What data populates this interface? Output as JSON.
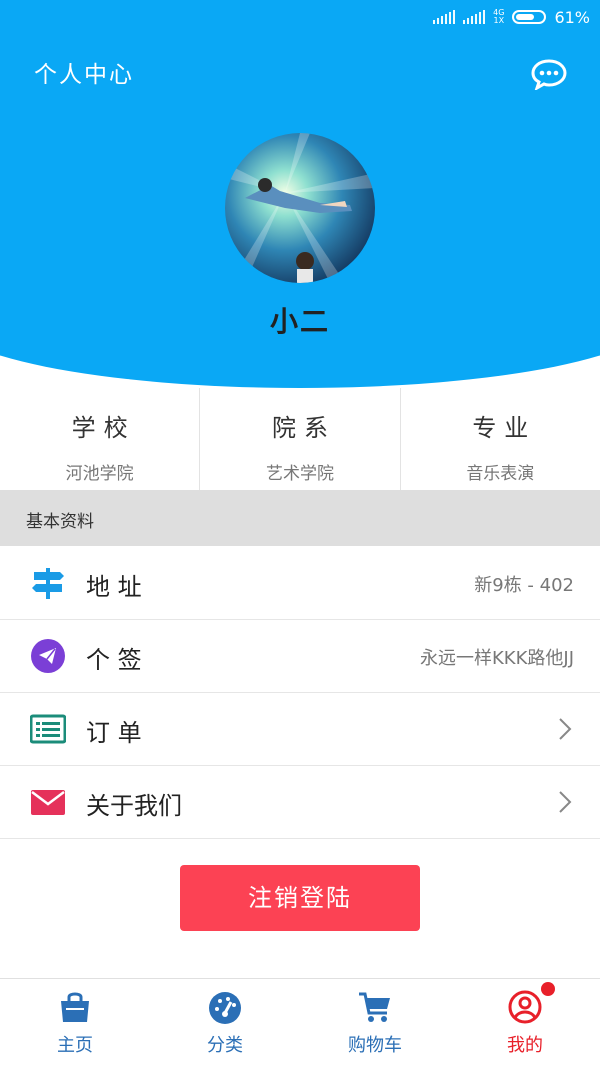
{
  "status": {
    "battery": "61%",
    "network": "4G",
    "network_sub": "1X",
    "battery_level": 0.61
  },
  "header": {
    "title": "个人中心"
  },
  "profile": {
    "name": "小二"
  },
  "info": [
    {
      "title": "学校",
      "value": "河池学院"
    },
    {
      "title": "院系",
      "value": "艺术学院"
    },
    {
      "title": "专业",
      "value": "音乐表演"
    }
  ],
  "section": {
    "title": "基本资料"
  },
  "rows": [
    {
      "label": "地 址",
      "value": "新9栋 - 402",
      "icon": "signpost-icon"
    },
    {
      "label": "个 签",
      "value": "永远一样KKK路他JJ",
      "icon": "paper-plane-icon"
    },
    {
      "label": "订 单",
      "value": "",
      "icon": "list-icon"
    },
    {
      "label": "关于我们",
      "value": "",
      "icon": "mail-icon"
    }
  ],
  "logout": {
    "label": "注销登陆"
  },
  "nav": [
    {
      "label": "主页",
      "icon": "shopping-bag-icon"
    },
    {
      "label": "分类",
      "icon": "gauge-icon"
    },
    {
      "label": "购物车",
      "icon": "cart-icon"
    },
    {
      "label": "我的",
      "icon": "user-icon"
    }
  ],
  "colors": {
    "primary": "#0aa8f5",
    "logout": "#fc4254",
    "nav": "#2b6fb6",
    "active": "#e8202a"
  }
}
